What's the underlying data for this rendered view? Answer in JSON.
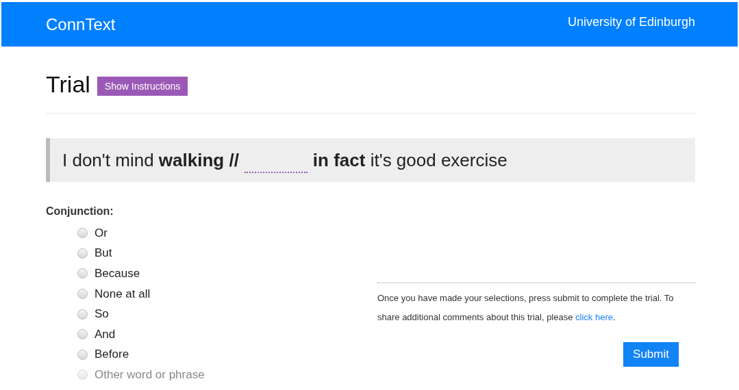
{
  "navbar": {
    "brand": "ConnText",
    "institution": "University of Edinburgh"
  },
  "heading": {
    "title": "Trial",
    "button": "Show Instructions"
  },
  "sentence": {
    "before": "I don't mind **walking //**",
    "after": "**in fact** it's good exercise"
  },
  "question": {
    "label": "Conjunction:",
    "options": [
      {
        "label": "Or",
        "selected": false,
        "disabled": false
      },
      {
        "label": "But",
        "selected": false,
        "disabled": false
      },
      {
        "label": "Because",
        "selected": false,
        "disabled": false
      },
      {
        "label": "None at all",
        "selected": false,
        "disabled": false
      },
      {
        "label": "So",
        "selected": false,
        "disabled": false
      },
      {
        "label": "And",
        "selected": false,
        "disabled": false
      },
      {
        "label": "Before",
        "selected": false,
        "disabled": false
      },
      {
        "label": "Other word or phrase",
        "selected": false,
        "disabled": true
      }
    ]
  },
  "footer_note": {
    "text_before": "Once you have made your selections, press submit to complete the trial. To share additional comments about this trial, please",
    "link": "click here",
    "text_after": "."
  },
  "submit_button": "Submit"
}
